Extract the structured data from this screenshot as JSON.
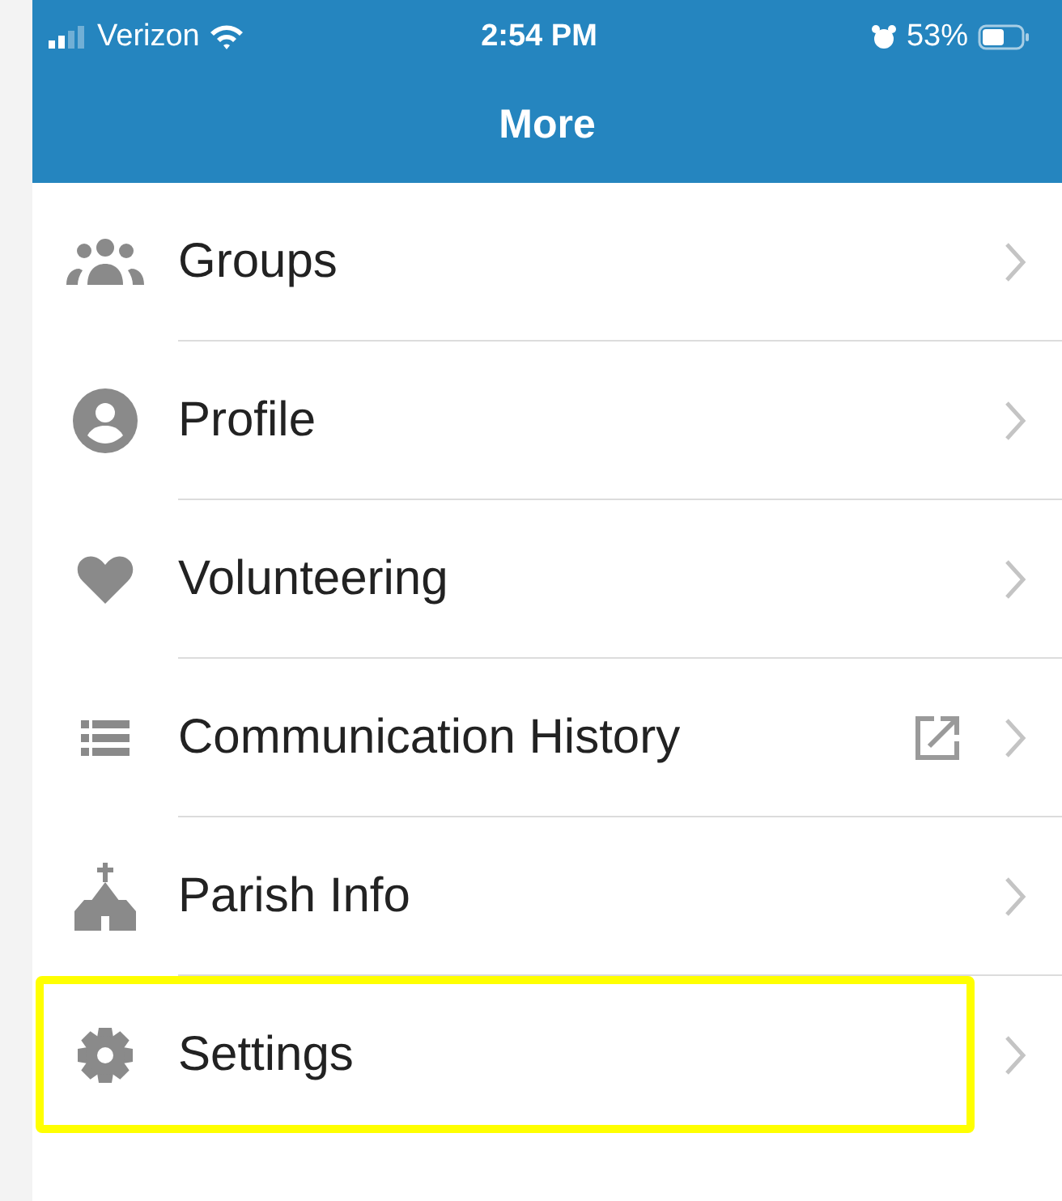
{
  "status_bar": {
    "carrier": "Verizon",
    "time": "2:54 PM",
    "battery": "53%"
  },
  "header": {
    "title": "More"
  },
  "menu": [
    {
      "label": "Groups",
      "external": false,
      "highlighted": false
    },
    {
      "label": "Profile",
      "external": false,
      "highlighted": false
    },
    {
      "label": "Volunteering",
      "external": false,
      "highlighted": false
    },
    {
      "label": "Communication History",
      "external": true,
      "highlighted": false
    },
    {
      "label": "Parish Info",
      "external": false,
      "highlighted": false
    },
    {
      "label": "Settings",
      "external": false,
      "highlighted": true
    }
  ]
}
